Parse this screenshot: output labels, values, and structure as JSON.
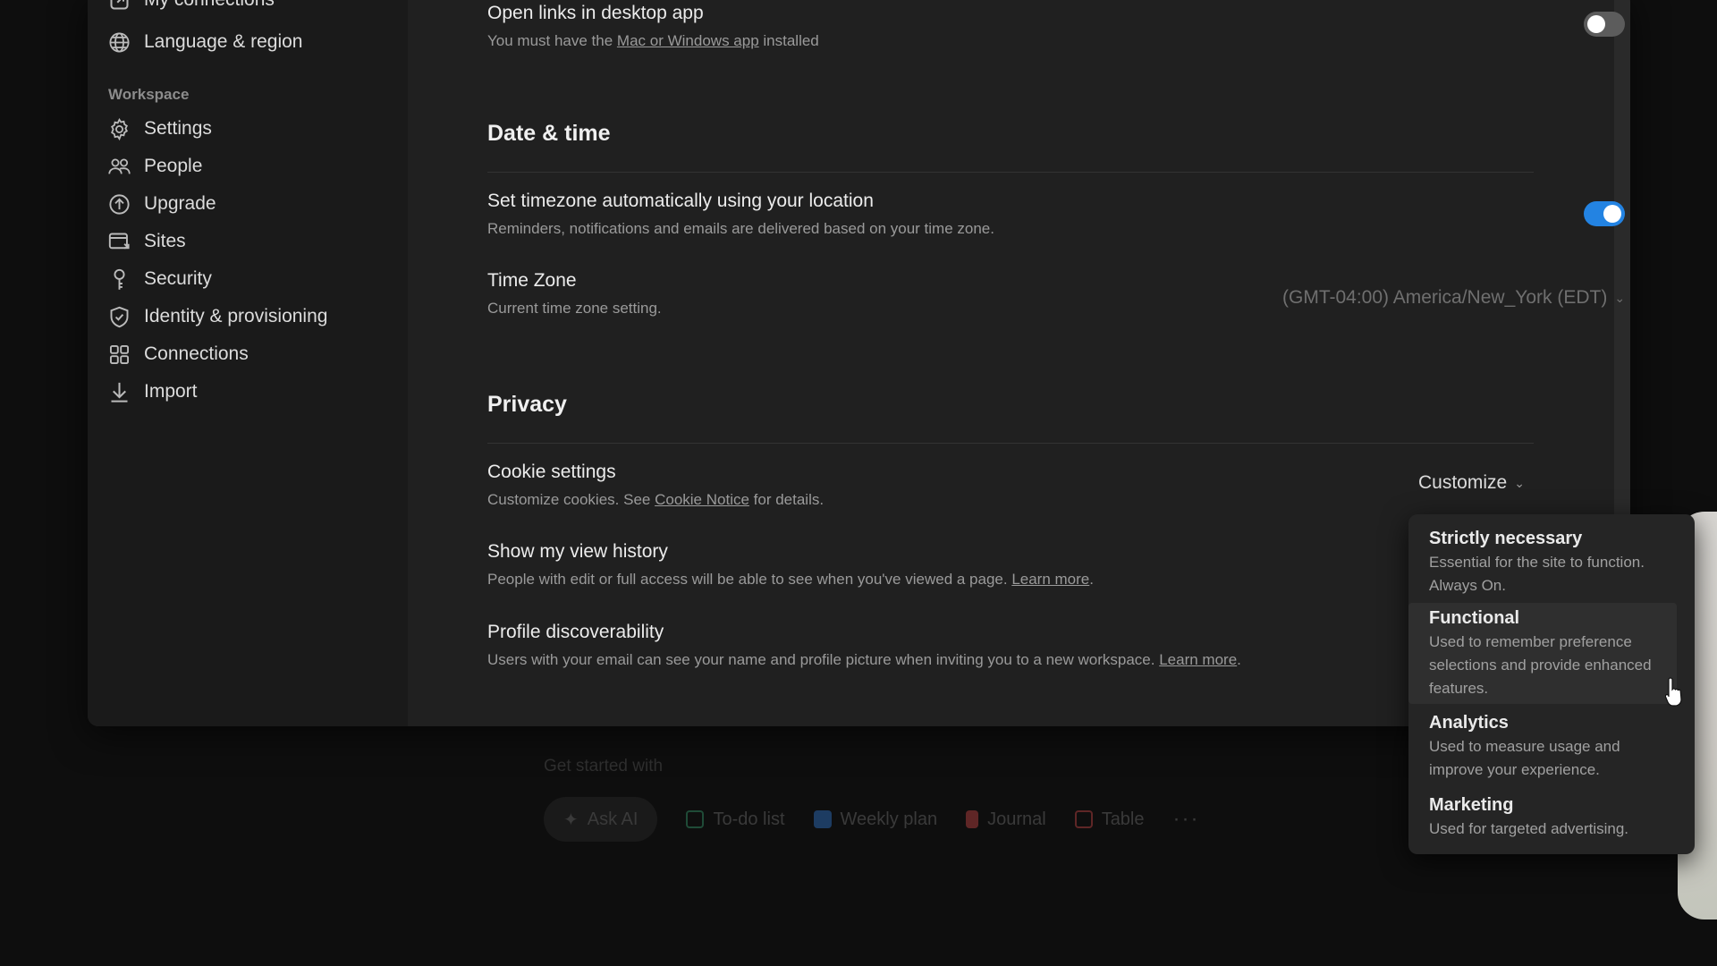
{
  "background": {
    "get_started_label": "Get started with",
    "actions": [
      {
        "label": "Ask AI",
        "icon": "sparkle-icon"
      },
      {
        "label": "To-do list",
        "icon": "checkbox-icon",
        "color": "#2e7d5a"
      },
      {
        "label": "Weekly plan",
        "icon": "calendar-icon",
        "color": "#2a62a8"
      },
      {
        "label": "Journal",
        "icon": "bookmark-icon",
        "color": "#a33a3a"
      },
      {
        "label": "Table",
        "icon": "table-icon",
        "color": "#a33a3a"
      }
    ],
    "more": "···"
  },
  "sidebar": {
    "top_items": [
      {
        "label": "My connections",
        "icon": "external-link-icon"
      },
      {
        "label": "Language & region",
        "icon": "globe-icon"
      }
    ],
    "workspace_heading": "Workspace",
    "workspace_items": [
      {
        "label": "Settings",
        "icon": "gear-icon"
      },
      {
        "label": "People",
        "icon": "people-icon"
      },
      {
        "label": "Upgrade",
        "icon": "upgrade-icon"
      },
      {
        "label": "Sites",
        "icon": "sites-icon"
      },
      {
        "label": "Security",
        "icon": "key-icon"
      },
      {
        "label": "Identity & provisioning",
        "icon": "shield-check-icon"
      },
      {
        "label": "Connections",
        "icon": "grid-icon"
      },
      {
        "label": "Import",
        "icon": "download-icon"
      }
    ]
  },
  "main": {
    "open_links": {
      "title": "Open links in desktop app",
      "desc_prefix": "You must have the ",
      "desc_link": "Mac or Windows app",
      "desc_suffix": " installed",
      "toggle_on": false
    },
    "date_time": {
      "section_title": "Date & time",
      "auto_timezone": {
        "title": "Set timezone automatically using your location",
        "desc": "Reminders, notifications and emails are delivered based on your time zone.",
        "toggle_on": true
      },
      "time_zone": {
        "title": "Time Zone",
        "desc": "Current time zone setting.",
        "value": "(GMT-04:00) America/New_York (EDT)"
      }
    },
    "privacy": {
      "section_title": "Privacy",
      "cookie": {
        "title": "Cookie settings",
        "desc_prefix": "Customize cookies. See ",
        "desc_link": "Cookie Notice",
        "desc_suffix": " for details.",
        "value": "Customize"
      },
      "view_history": {
        "title": "Show my view history",
        "desc": "People with edit or full access will be able to see when you've viewed a page. ",
        "link": "Learn more",
        "suffix": "."
      },
      "discoverability": {
        "title": "Profile discoverability",
        "desc": "Users with your email can see your name and profile picture when inviting you to a new workspace. ",
        "link": "Learn more",
        "suffix": "."
      }
    }
  },
  "cookie_menu": {
    "options": [
      {
        "title": "Strictly necessary",
        "desc_lines": [
          "Essential for the site to function.",
          "Always On."
        ]
      },
      {
        "title": "Functional",
        "desc_lines": [
          "Used to remember preference",
          "selections and provide enhanced",
          "features."
        ],
        "highlighted": true
      },
      {
        "title": "Analytics",
        "desc_lines": [
          "Used to measure usage and",
          "improve your experience."
        ]
      },
      {
        "title": "Marketing",
        "desc_lines": [
          "Used for targeted advertising."
        ]
      }
    ]
  },
  "colors": {
    "accent": "#2383e2",
    "window_bg": "#202020",
    "sidebar_bg": "#1a1a1a"
  }
}
